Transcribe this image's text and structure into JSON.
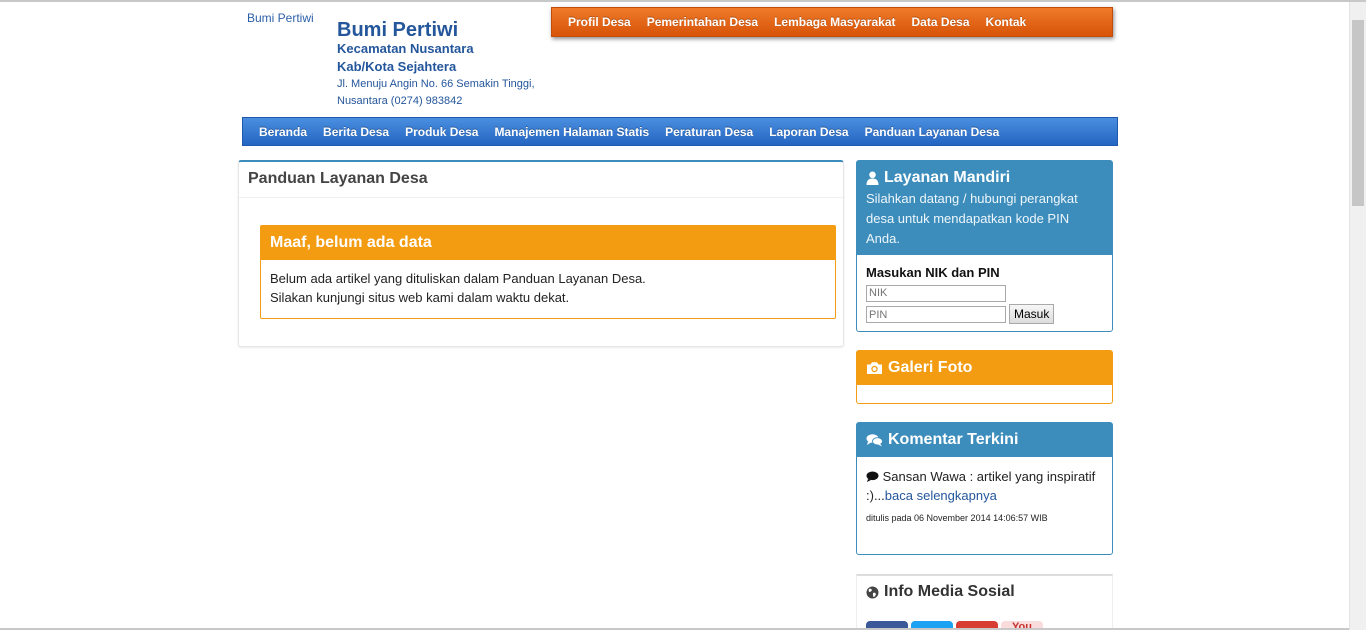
{
  "header": {
    "logo_alt": "Bumi Pertiwi",
    "title": "Bumi Pertiwi",
    "kecamatan": "Kecamatan Nusantara",
    "kabupaten": "Kab/Kota Sejahtera",
    "address_line1": "Jl. Menuju Angin No. 66 Semakin Tinggi,",
    "address_line2": "Nusantara (0274) 983842"
  },
  "top_nav": [
    "Profil Desa",
    "Pemerintahan Desa",
    "Lembaga Masyarakat",
    "Data Desa",
    "Kontak"
  ],
  "main_nav": [
    "Beranda",
    "Berita Desa",
    "Produk Desa",
    "Manajemen Halaman Statis",
    "Peraturan Desa",
    "Laporan Desa",
    "Panduan Layanan Desa"
  ],
  "content": {
    "title": "Panduan Layanan Desa",
    "alert_title": "Maaf, belum ada data",
    "alert_line1": "Belum ada artikel yang dituliskan dalam Panduan Layanan Desa.",
    "alert_line2": "Silakan kunjungi situs web kami dalam waktu dekat."
  },
  "layanan_mandiri": {
    "icon": "user-icon",
    "title": "Layanan Mandiri",
    "description": "Silahkan datang / hubungi perangkat desa untuk mendapatkan kode PIN Anda.",
    "form_label": "Masukan NIK dan PIN",
    "nik_placeholder": "NIK",
    "pin_placeholder": "PIN",
    "submit_label": "Masuk"
  },
  "galeri": {
    "icon": "camera-icon",
    "title": "Galeri Foto"
  },
  "komentar": {
    "icon": "comments-icon",
    "title": "Komentar Terkini",
    "author_text": "Sansan Wawa : artikel yang inspiratif :)...",
    "read_more": "baca selengkapnya",
    "meta": "ditulis pada 06 November 2014 14:06:57 WIB"
  },
  "media_sosial": {
    "icon": "globe-icon",
    "title": "Info Media Sosial",
    "items": [
      "facebook",
      "twitter",
      "google-plus",
      "youtube"
    ],
    "youtube_label": "You"
  },
  "colors": {
    "primary": "#3c8dbc",
    "warning": "#f39c12",
    "top_nav": "#e0631a",
    "main_nav": "#2d6fcc"
  }
}
